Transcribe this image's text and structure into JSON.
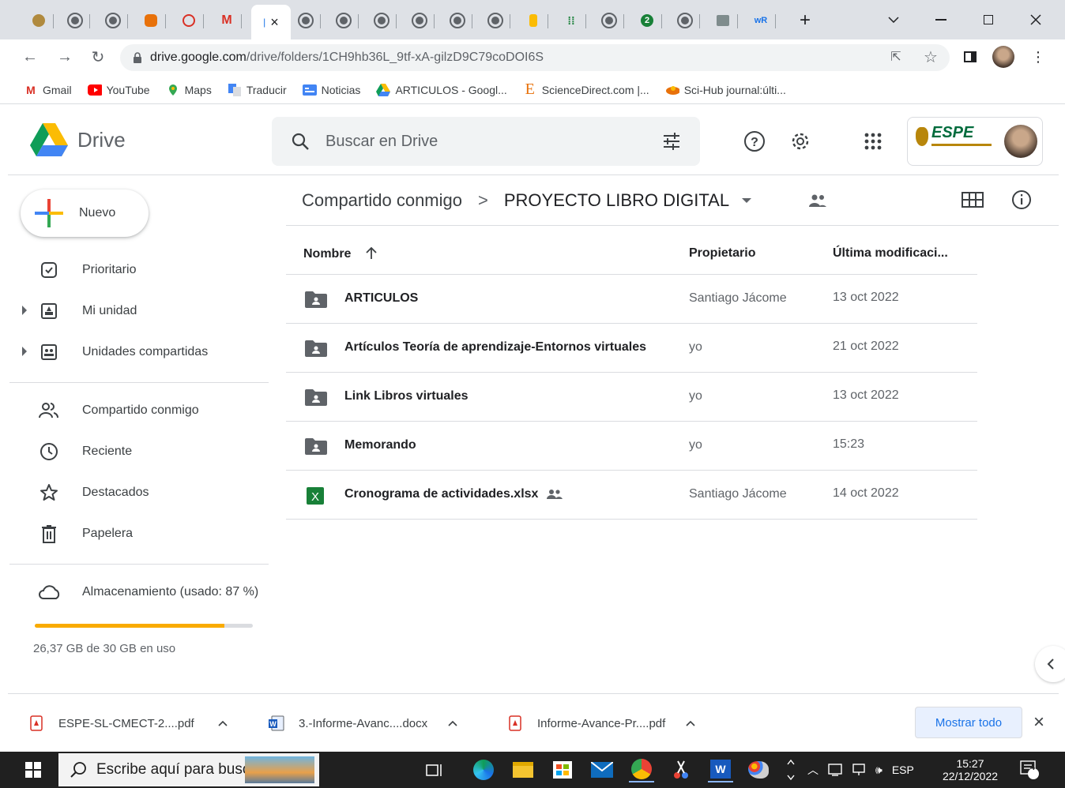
{
  "browser": {
    "active_tab_close": "×",
    "new_tab": "+",
    "url_host": "drive.google.com",
    "url_path": "/drive/folders/1CH9hb36L_9tf-xA-gilzD9C79coDOI6S"
  },
  "bookmarks": [
    {
      "label": "Gmail",
      "icon": "gmail-icon"
    },
    {
      "label": "YouTube",
      "icon": "youtube-icon"
    },
    {
      "label": "Maps",
      "icon": "maps-icon"
    },
    {
      "label": "Traducir",
      "icon": "translate-icon"
    },
    {
      "label": "Noticias",
      "icon": "news-icon"
    },
    {
      "label": "ARTICULOS - Googl...",
      "icon": "drive-icon"
    },
    {
      "label": "ScienceDirect.com |...",
      "icon": "elsevier-icon"
    },
    {
      "label": "Sci-Hub journal:últi...",
      "icon": "scihub-icon"
    }
  ],
  "drive": {
    "app_name": "Drive",
    "search_placeholder": "Buscar en Drive",
    "account_logo_text": "ESPE"
  },
  "sidebar": {
    "new_label": "Nuevo",
    "items": [
      {
        "label": "Prioritario",
        "icon": "priority-icon"
      },
      {
        "label": "Mi unidad",
        "icon": "my-drive-icon"
      },
      {
        "label": "Unidades compartidas",
        "icon": "shared-drives-icon"
      },
      {
        "label": "Compartido conmigo",
        "icon": "shared-with-me-icon"
      },
      {
        "label": "Reciente",
        "icon": "clock-icon"
      },
      {
        "label": "Destacados",
        "icon": "star-icon"
      },
      {
        "label": "Papelera",
        "icon": "trash-icon"
      },
      {
        "label": "Almacenamiento (usado: 87 %)",
        "icon": "cloud-icon"
      }
    ],
    "storage_used_fraction": 0.87,
    "storage_text": "26,37 GB de 30 GB en uso"
  },
  "breadcrumb": {
    "parent": "Compartido conmigo",
    "separator": ">",
    "current": "PROYECTO LIBRO DIGITAL"
  },
  "table": {
    "headers": {
      "name": "Nombre",
      "owner": "Propietario",
      "modified": "Última modificaci..."
    },
    "rows": [
      {
        "name": "ARTICULOS",
        "owner": "Santiago Jácome",
        "modified": "13 oct 2022",
        "type": "folder"
      },
      {
        "name": "Artículos Teoría de aprendizaje-Entornos virtuales",
        "owner": "yo",
        "modified": "21 oct 2022",
        "type": "folder"
      },
      {
        "name": "Link Libros virtuales",
        "owner": "yo",
        "modified": "13 oct 2022",
        "type": "folder"
      },
      {
        "name": "Memorando",
        "owner": "yo",
        "modified": "15:23",
        "type": "folder"
      },
      {
        "name": "Cronograma de actividades.xlsx",
        "owner": "Santiago Jácome",
        "modified": "14 oct 2022",
        "type": "sheet"
      }
    ]
  },
  "downloads": {
    "items": [
      {
        "name": "ESPE-SL-CMECT-2....pdf",
        "icon": "pdf-icon"
      },
      {
        "name": "3.-Informe-Avanc....docx",
        "icon": "word-icon"
      },
      {
        "name": "Informe-Avance-Pr....pdf",
        "icon": "pdf-icon"
      }
    ],
    "show_all": "Mostrar todo",
    "close": "×"
  },
  "taskbar": {
    "search_placeholder": "Escribe aquí para buscar",
    "lang": "ESP",
    "time": "15:27",
    "date": "22/12/2022",
    "notifications": "4"
  },
  "colors": {
    "accent_blue": "#1a73e8",
    "storage_fill": "#f9ab00",
    "folder_gray": "#5f6368",
    "sheet_green": "#188038"
  }
}
